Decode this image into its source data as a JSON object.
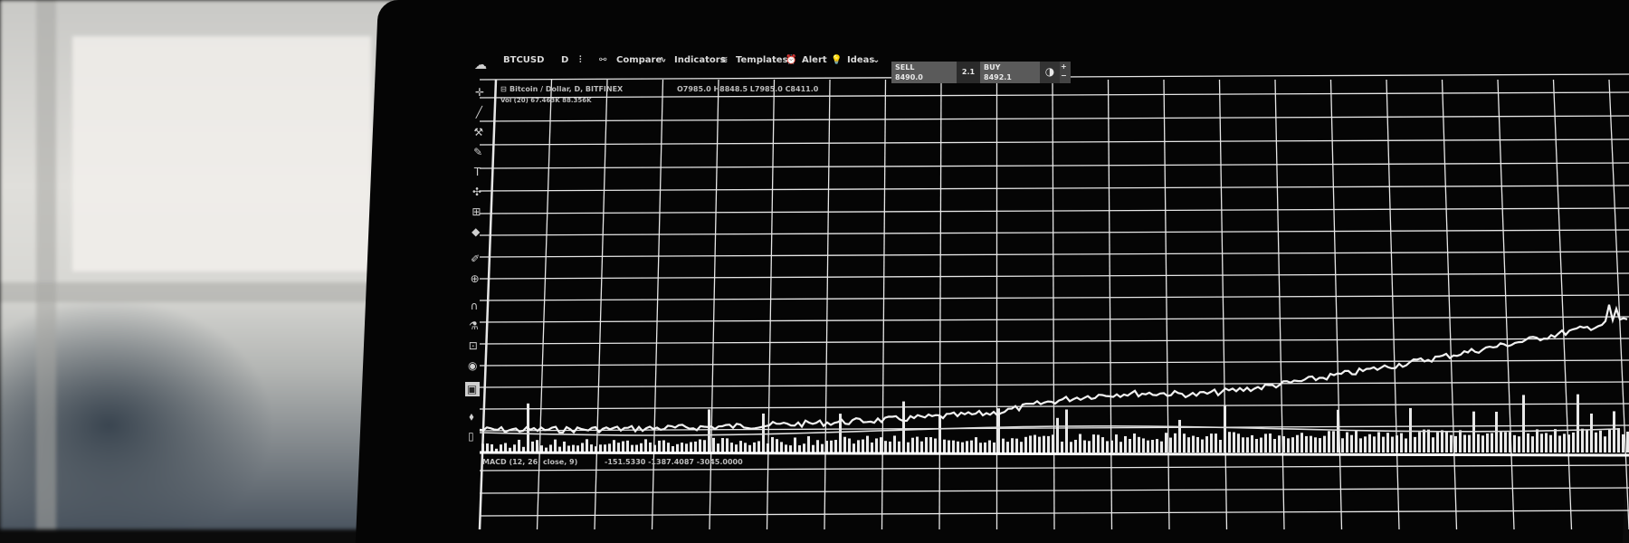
{
  "toolbar": {
    "symbol": "BTCUSD",
    "interval": "D",
    "compare": "Compare",
    "indicators": "Indicators",
    "templates": "Templates",
    "alert": "Alert",
    "ideas": "Ideas"
  },
  "trade": {
    "sell_label": "SELL",
    "sell_price": "8490.0",
    "spread": "2.1",
    "buy_label": "BUY",
    "buy_price": "8492.1"
  },
  "legend": {
    "title": "Bitcoin / Dollar, D, BITFINEX",
    "ohlc": "O7985.0  H8848.5  L7985.0  C8411.0",
    "volume": "Vol (20)  67.463K  88.356K"
  },
  "sub_legend": {
    "name": "MACD (12, 26, close, 9)",
    "values": "-151.5330  -1387.4087  -3045.0000"
  },
  "colors": {
    "screen_bg": "#000000",
    "grid": "#e6e6e6",
    "price_line": "#f2f2f2",
    "toolbar_text": "#d9d9d9"
  },
  "tools": [
    "crosshair-icon",
    "trend-line-icon",
    "fib-icon",
    "brush-icon",
    "text-icon",
    "pattern-icon",
    "measure-icon",
    "shapes-icon",
    "ruler-icon",
    "zoom-in-icon",
    "magnet-icon",
    "lock-drawing-icon",
    "unlock-icon",
    "eye-icon",
    "layer-icon",
    "delete-icon",
    "trash-icon"
  ]
}
